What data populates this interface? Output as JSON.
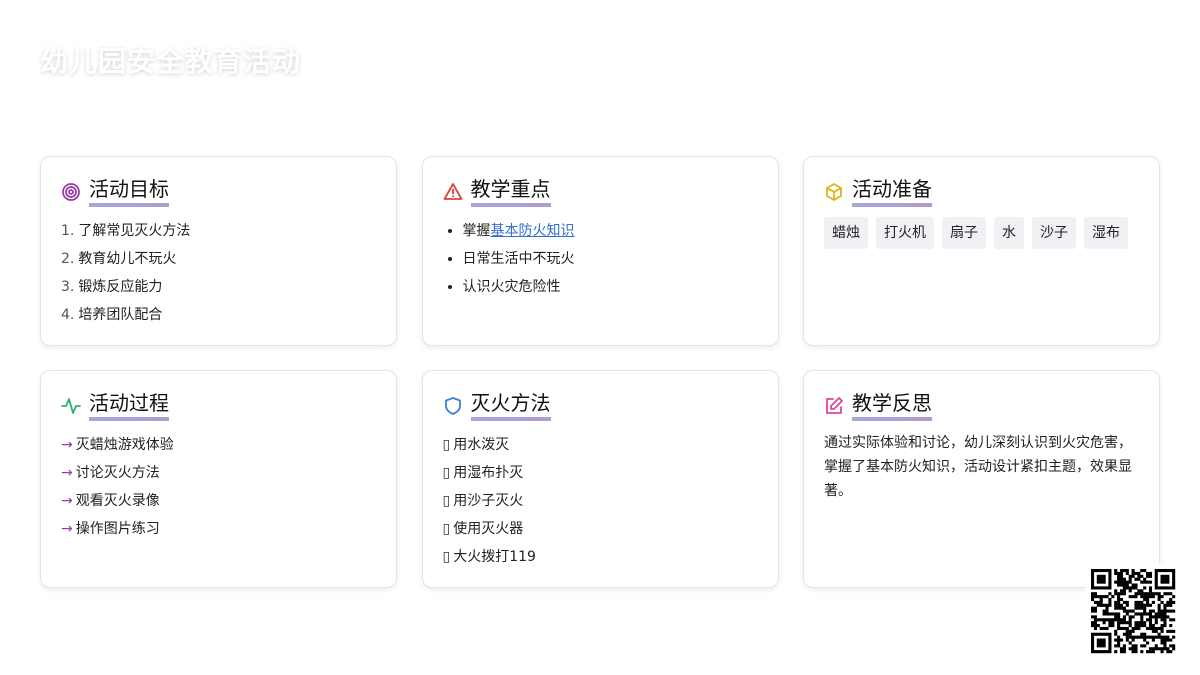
{
  "page": {
    "title": "幼儿园安全教育活动"
  },
  "cards": {
    "goals": {
      "title": "活动目标",
      "items": [
        {
          "num": "1.",
          "text": "了解常见灭火方法"
        },
        {
          "num": "2.",
          "text": "教育幼儿不玩火"
        },
        {
          "num": "3.",
          "text": "锻炼反应能力"
        },
        {
          "num": "4.",
          "text": "培养团队配合"
        }
      ]
    },
    "focus": {
      "title": "教学重点",
      "item1_prefix": "掌握",
      "item1_link": "基本防火知识",
      "item2": "日常生活中不玩火",
      "item3": "认识火灾危险性"
    },
    "prep": {
      "title": "活动准备",
      "tags": [
        "蜡烛",
        "打火机",
        "扇子",
        "水",
        "沙子",
        "湿布"
      ]
    },
    "process": {
      "title": "活动过程",
      "arrow": "→",
      "items": [
        "灭蜡烛游戏体验",
        "讨论灭火方法",
        "观看灭火录像",
        "操作图片练习"
      ]
    },
    "methods": {
      "title": "灭火方法",
      "box": "▯",
      "items": [
        "用水泼灭",
        "用湿布扑灭",
        "用沙子灭火",
        "使用灭火器",
        "大火拨打119"
      ]
    },
    "reflection": {
      "title": "教学反思",
      "text": "通过实际体验和讨论，幼儿深刻认识到火灾危害，掌握了基本防火知识，活动设计紧扣主题，效果显著。"
    }
  },
  "icons": {
    "goals": "target-icon",
    "focus": "alert-triangle-icon",
    "prep": "package-icon",
    "process": "activity-icon",
    "methods": "shield-icon",
    "reflection": "edit-icon"
  },
  "colors": {
    "goals_icon": "#9b3aa8",
    "focus_icon": "#d9443f",
    "prep_icon": "#e0b418",
    "process_icon": "#2fb36a",
    "methods_icon": "#3b82d6",
    "reflection_icon": "#d9489b",
    "title_underline": "#a5a7d6"
  }
}
